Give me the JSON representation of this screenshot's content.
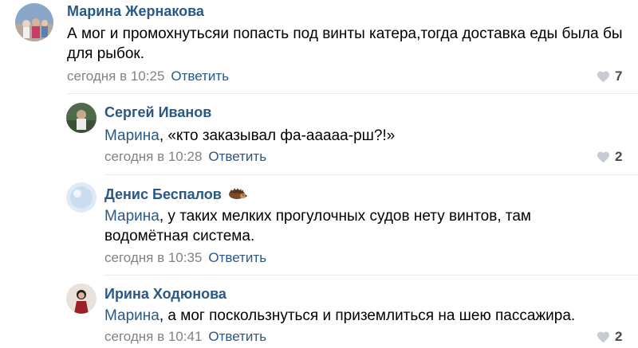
{
  "comments": [
    {
      "author": "Марина Жернакова",
      "text": "А мог и промохнутьсяи попасть под винты катера,тогда доставка еды была бы для рыбок.",
      "time": "сегодня в 10:25",
      "reply_label": "Ответить",
      "likes": "7"
    },
    {
      "author": "Сергей Иванов",
      "mention": "Марина",
      "text": ", «кто заказывал фа-ааааа-рш?!»",
      "time": "сегодня в 10:28",
      "reply_label": "Ответить",
      "likes": "2"
    },
    {
      "author": "Денис Беспалов",
      "mention": "Марина",
      "text": ", у таких мелких прогулочных судов нету винтов, там водомётная система.",
      "time": "сегодня в 10:35",
      "reply_label": "Ответить"
    },
    {
      "author": "Ирина Ходюнова",
      "mention": "Марина",
      "text": ", а мог поскользнуться и приземлиться на шею пассажира.",
      "time": "сегодня в 10:41",
      "reply_label": "Ответить",
      "likes": "2"
    }
  ],
  "colors": {
    "link": "#2a5885",
    "meta": "#828282",
    "heart": "#c7ccd4"
  },
  "icons": {
    "like": "heart-icon",
    "author_badge": "hedgehog-emoji-icon"
  }
}
